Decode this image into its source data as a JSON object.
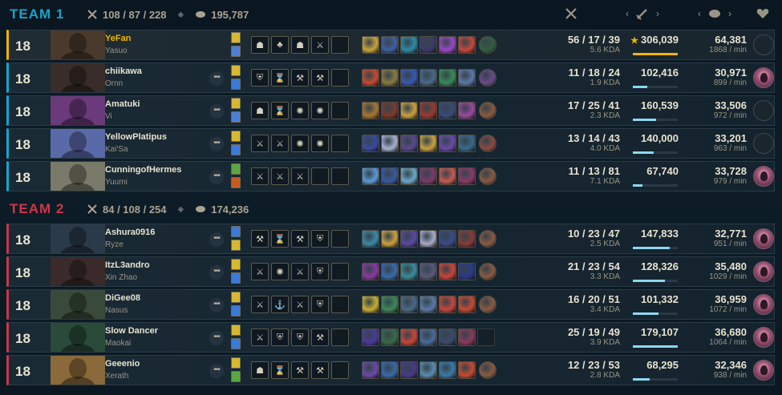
{
  "teams": [
    {
      "title": "TEAM 1",
      "kda": "108 / 87 / 228",
      "gold": "195,787",
      "players": [
        {
          "level": "18",
          "name": "YeFan",
          "champion": "Yasuo",
          "kda": "56 / 17 / 39",
          "kda_ratio": "5.6 KDA",
          "damage": "306,039",
          "damage_fraction": 1.0,
          "gold": "64,381",
          "gold_per_min": "1868 / min",
          "self": true,
          "honor": false,
          "runes": [
            "☗",
            "♣",
            "☗",
            "⚔"
          ],
          "spell_colors": [
            "#d8b830",
            "#4a80d8"
          ],
          "portrait": "#4a3a2c",
          "items": [
            "#c9a33a",
            "#3e5fa0",
            "#2c8ba8",
            "#3a3a6a",
            "#9a48c8",
            "#c8463a",
            "#2f6040"
          ]
        },
        {
          "level": "18",
          "name": "chiikawa",
          "champion": "Ornn",
          "kda": "11 / 18 / 24",
          "kda_ratio": "1.9 KDA",
          "damage": "102,416",
          "damage_fraction": 0.33,
          "gold": "30,971",
          "gold_per_min": "899 / min",
          "self": false,
          "honor": true,
          "runes": [
            "⛨",
            "⌛",
            "⚒",
            "⚒"
          ],
          "spell_colors": [
            "#d8b830",
            "#3a7ad8"
          ],
          "portrait": "#3a2c28",
          "items": [
            "#c84a30",
            "#8a7a40",
            "#3a5ab0",
            "#4a6a8a",
            "#3a8a5a",
            "#5a7aa8",
            "#6a4a8a"
          ]
        },
        {
          "level": "18",
          "name": "Amatuki",
          "champion": "Vi",
          "kda": "17 / 25 / 41",
          "kda_ratio": "2.3 KDA",
          "damage": "160,539",
          "damage_fraction": 0.52,
          "gold": "33,506",
          "gold_per_min": "972 / min",
          "self": false,
          "honor": false,
          "runes": [
            "☗",
            "⌛",
            "✺",
            "✺"
          ],
          "spell_colors": [
            "#d8b830",
            "#4a80d8"
          ],
          "portrait": "#6a3a7a",
          "items": [
            "#a87830",
            "#7a3a2a",
            "#c8a040",
            "#9a3a30",
            "#3a4a7a",
            "#9a4aa0",
            "#8a5a40"
          ]
        },
        {
          "level": "18",
          "name": "YellowPlatipus",
          "champion": "Kai'Sa",
          "kda": "13 / 14 / 43",
          "kda_ratio": "4.0 KDA",
          "damage": "140,000",
          "damage_fraction": 0.46,
          "gold": "33,201",
          "gold_per_min": "963 / min",
          "self": false,
          "honor": false,
          "runes": [
            "⚔",
            "⚔",
            "✺",
            "✺"
          ],
          "spell_colors": [
            "#d8b830",
            "#3a7ad8"
          ],
          "portrait": "#5a6aa8",
          "items": [
            "#3a4aa0",
            "#a8b0d0",
            "#5a4a8a",
            "#c8a040",
            "#6a4aa8",
            "#3a6a8a",
            "#8a4a40"
          ]
        },
        {
          "level": "18",
          "name": "CunningofHermes",
          "champion": "Yuumi",
          "kda": "11 / 13 / 81",
          "kda_ratio": "7.1 KDA",
          "damage": "67,740",
          "damage_fraction": 0.22,
          "gold": "33,728",
          "gold_per_min": "979 / min",
          "self": false,
          "honor": true,
          "runes": [
            "⚔",
            "⚔",
            "⚔",
            "",
            ""
          ],
          "spell_colors": [
            "#5aa840",
            "#c85a20"
          ],
          "portrait": "#7a7a6a",
          "items": [
            "#5a9ad8",
            "#3a5aa0",
            "#6aa8c8",
            "#7a3a6a",
            "#c85a50",
            "#8a3a6a",
            "#8a5a40"
          ]
        }
      ]
    },
    {
      "title": "TEAM 2",
      "kda": "84 / 108 / 254",
      "gold": "174,236",
      "players": [
        {
          "level": "18",
          "name": "Ashura0916",
          "champion": "Ryze",
          "kda": "10 / 23 / 47",
          "kda_ratio": "2.5 KDA",
          "damage": "147,833",
          "damage_fraction": 0.83,
          "gold": "32,771",
          "gold_per_min": "951 / min",
          "self": false,
          "honor": true,
          "runes": [
            "⚒",
            "⌛",
            "⚒",
            "⛨"
          ],
          "spell_colors": [
            "#3a7ad8",
            "#d8b830"
          ],
          "portrait": "#2a3a4a",
          "items": [
            "#3a8aa8",
            "#c8a040",
            "#5a4aa0",
            "#a8a8c8",
            "#3a4a8a",
            "#8a3a3a",
            "#8a5a40"
          ]
        },
        {
          "level": "18",
          "name": "ItzL3andro",
          "champion": "Xin Zhao",
          "kda": "21 / 23 / 54",
          "kda_ratio": "3.3 KDA",
          "damage": "128,326",
          "damage_fraction": 0.72,
          "gold": "35,480",
          "gold_per_min": "1029 / min",
          "self": false,
          "honor": true,
          "runes": [
            "⚔",
            "✺",
            "⚔",
            "⛨"
          ],
          "spell_colors": [
            "#d8b830",
            "#3a7ad8"
          ],
          "portrait": "#3a2a2a",
          "items": [
            "#8a3aa0",
            "#3a6aa8",
            "#3a8a9a",
            "#5a5a7a",
            "#c8463a",
            "#2a3a8a",
            "#8a5a40"
          ]
        },
        {
          "level": "18",
          "name": "DiGee08",
          "champion": "Nasus",
          "kda": "16 / 20 / 51",
          "kda_ratio": "3.4 KDA",
          "damage": "101,332",
          "damage_fraction": 0.57,
          "gold": "36,959",
          "gold_per_min": "1072 / min",
          "self": false,
          "honor": true,
          "runes": [
            "⚔",
            "⚓",
            "⚔",
            "⛨"
          ],
          "spell_colors": [
            "#d8b830",
            "#3a7ad8"
          ],
          "portrait": "#3a4a3a",
          "items": [
            "#c8b030",
            "#3a8a5a",
            "#4a6a8a",
            "#5a7aa8",
            "#c8463a",
            "#c84a30",
            "#8a5a40"
          ]
        },
        {
          "level": "18",
          "name": "Slow Dancer",
          "champion": "Maokai",
          "kda": "25 / 19 / 49",
          "kda_ratio": "3.9 KDA",
          "damage": "179,107",
          "damage_fraction": 1.0,
          "gold": "36,680",
          "gold_per_min": "1064 / min",
          "self": false,
          "honor": true,
          "runes": [
            "⚔",
            "⛨",
            "⛨",
            "⚒"
          ],
          "spell_colors": [
            "#d8b830",
            "#3a7ad8"
          ],
          "portrait": "#2a4a3a",
          "items": [
            "#4a3aa0",
            "#3a6a4a",
            "#c8463a",
            "#4a6a9a",
            "#3a4a6a",
            "#8a3a5a",
            ""
          ]
        },
        {
          "level": "18",
          "name": "Geeenio",
          "champion": "Xerath",
          "kda": "12 / 23 / 53",
          "kda_ratio": "2.8 KDA",
          "damage": "68,295",
          "damage_fraction": 0.38,
          "gold": "32,346",
          "gold_per_min": "938 / min",
          "self": false,
          "honor": true,
          "runes": [
            "☗",
            "⌛",
            "⚒",
            "⚒"
          ],
          "spell_colors": [
            "#d8b830",
            "#5aa840"
          ],
          "portrait": "#8a6a3a",
          "items": [
            "#6a4aa8",
            "#3a6aa8",
            "#4a3a8a",
            "#5a8ab0",
            "#3a7aa8",
            "#c84a30",
            "#8a5a40"
          ]
        }
      ]
    }
  ],
  "icons": {
    "kda": "crossed-swords-icon",
    "gold": "gold-coins-icon",
    "damage": "sword-icon",
    "honor": "honor-heart-icon"
  }
}
